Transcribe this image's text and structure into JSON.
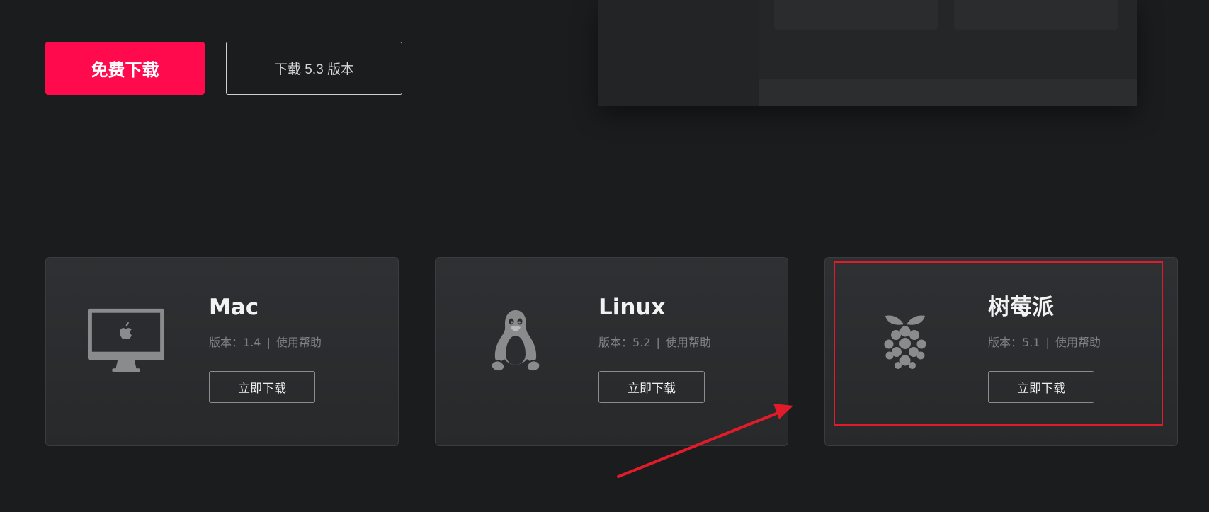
{
  "hero": {
    "primary_button": "免费下载",
    "secondary_button": "下载 5.3 版本"
  },
  "cards": [
    {
      "title": "Mac",
      "version_label": "版本：",
      "version": "1.4",
      "separator": "|",
      "help": "使用帮助",
      "button": "立即下载",
      "icon": "imac-apple-icon"
    },
    {
      "title": "Linux",
      "version_label": "版本：",
      "version": "5.2",
      "separator": "|",
      "help": "使用帮助",
      "button": "立即下载",
      "icon": "linux-penguin-icon"
    },
    {
      "title": "树莓派",
      "version_label": "版本：",
      "version": "5.1",
      "separator": "|",
      "help": "使用帮助",
      "button": "立即下载",
      "icon": "raspberry-pi-icon"
    }
  ],
  "colors": {
    "background": "#1b1c1e",
    "primary": "#ff0a4c",
    "annotation": "#e21b2a"
  }
}
